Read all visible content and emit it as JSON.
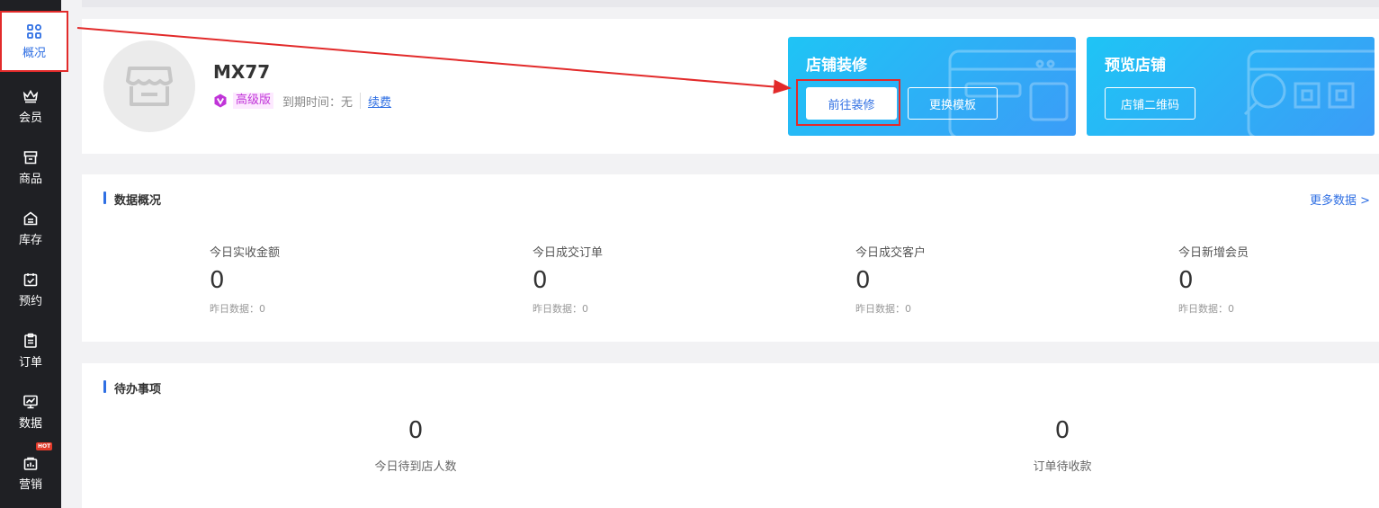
{
  "sidebar": {
    "items": [
      {
        "label": "概况",
        "icon": "grid-icon",
        "active": true
      },
      {
        "label": "会员",
        "icon": "crown-icon"
      },
      {
        "label": "商品",
        "icon": "store-icon"
      },
      {
        "label": "库存",
        "icon": "warehouse-icon"
      },
      {
        "label": "预约",
        "icon": "calendar-check-icon"
      },
      {
        "label": "订单",
        "icon": "clipboard-icon"
      },
      {
        "label": "数据",
        "icon": "chart-icon"
      },
      {
        "label": "营销",
        "icon": "shop-bag-icon",
        "badge": "HOT"
      }
    ]
  },
  "store": {
    "name": "MX77",
    "plan": "高级版",
    "expire": "到期时间：无",
    "renew": "续费"
  },
  "decorate_card": {
    "title": "店铺装修",
    "primary_button": "前往装修",
    "secondary_button": "更换模板"
  },
  "preview_card": {
    "title": "预览店铺",
    "button": "店铺二维码"
  },
  "data_overview": {
    "title": "数据概况",
    "more": "更多数据 >",
    "stats": [
      {
        "label": "今日实收金额",
        "value": "0",
        "sub": "昨日数据：0"
      },
      {
        "label": "今日成交订单",
        "value": "0",
        "sub": "昨日数据：0"
      },
      {
        "label": "今日成交客户",
        "value": "0",
        "sub": "昨日数据：0"
      },
      {
        "label": "今日新增会员",
        "value": "0",
        "sub": "昨日数据：0"
      }
    ]
  },
  "todo": {
    "title": "待办事项",
    "items": [
      {
        "value": "0",
        "label": "今日待到店人数"
      },
      {
        "value": "0",
        "label": "订单待收款"
      }
    ]
  },
  "colors": {
    "accent": "#2f6fe3",
    "sidebar_bg": "#1f2024",
    "annotation": "#e22a2a",
    "plan_text": "#c034d8"
  }
}
